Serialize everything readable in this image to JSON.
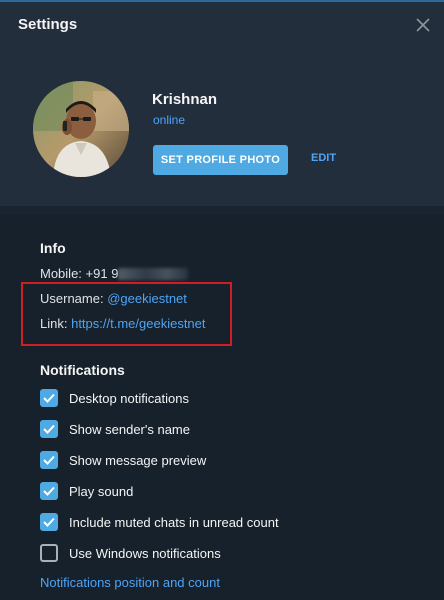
{
  "window": {
    "title": "Settings"
  },
  "profile": {
    "name": "Krishnan",
    "status": "online",
    "set_photo_label": "SET PROFILE PHOTO",
    "edit_label": "EDIT"
  },
  "info": {
    "heading": "Info",
    "mobile_label": "Mobile:",
    "mobile_value": "+91 9",
    "username_label": "Username:",
    "username_value": "@geekiestnet",
    "link_label": "Link:",
    "link_value": "https://t.me/geekiestnet"
  },
  "notifications": {
    "heading": "Notifications",
    "items": [
      {
        "label": "Desktop notifications",
        "checked": true
      },
      {
        "label": "Show sender's name",
        "checked": true
      },
      {
        "label": "Show message preview",
        "checked": true
      },
      {
        "label": "Play sound",
        "checked": true
      },
      {
        "label": "Include muted chats in unread count",
        "checked": true
      },
      {
        "label": "Use Windows notifications",
        "checked": false
      }
    ],
    "position_link": "Notifications position and count"
  },
  "colors": {
    "background": "#17212b",
    "header_background": "#232e3c",
    "accent": "#4fa9e2",
    "link": "#4ea4f6",
    "highlight_box": "#d21d23"
  }
}
